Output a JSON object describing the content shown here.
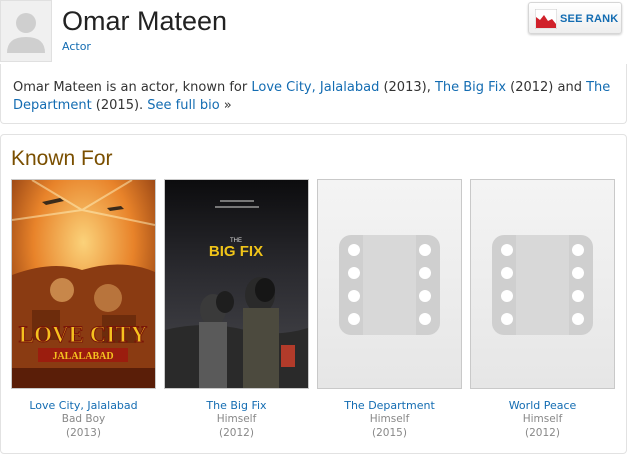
{
  "header": {
    "name": "Omar Mateen",
    "role": "Actor",
    "see_rank_label": "SEE RANK"
  },
  "bio": {
    "lead": "Omar Mateen is an actor, known for ",
    "film1": "Love City, Jalalabad",
    "year1": " (2013), ",
    "film2": "The Big Fix",
    "year2": " (2012) and ",
    "film3": "The Department",
    "year3": " (2015). ",
    "see_full_bio": "See full bio",
    "arrow": " »"
  },
  "known_for": {
    "heading": "Known For",
    "items": [
      {
        "title": "Love City, Jalalabad",
        "role": "Bad Boy",
        "year": "(2013)",
        "poster": "poster-love-city"
      },
      {
        "title": "The Big Fix",
        "role": "Himself",
        "year": "(2012)",
        "poster": "poster-big-fix"
      },
      {
        "title": "The Department",
        "role": "Himself",
        "year": "(2015)",
        "poster": "placeholder-film-icon"
      },
      {
        "title": "World Peace",
        "role": "Himself",
        "year": "(2012)",
        "poster": "placeholder-film-icon"
      }
    ]
  },
  "posters": {
    "love_city_title_line1": "LOVE CITY",
    "love_city_title_line2": "JALALABAD",
    "big_fix_title_line1": "THE",
    "big_fix_title_line2": "BIG FIX"
  }
}
